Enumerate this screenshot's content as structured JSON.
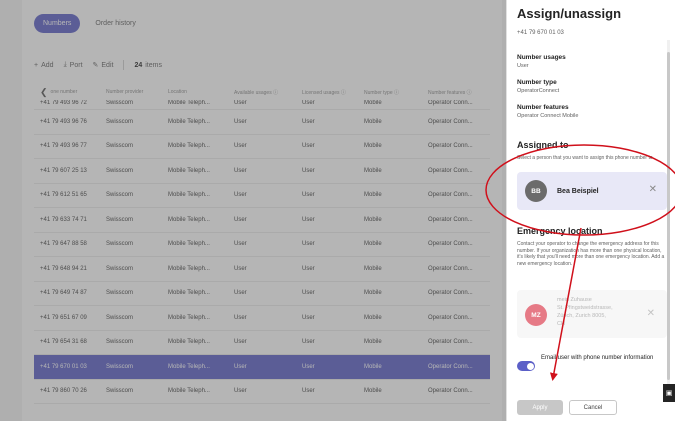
{
  "tabs": [
    {
      "label": "Numbers"
    },
    {
      "label": "Order history"
    }
  ],
  "toolbar": {
    "add": "Add",
    "port": "Port",
    "edit": "Edit",
    "count": "24",
    "items": "items"
  },
  "table": {
    "headers": [
      "one number",
      "Number provider",
      "Location",
      "Available usages",
      "Licensed usages",
      "Number type",
      "Number features"
    ],
    "first_row": {
      "number": "+41 79 493 96 72",
      "provider": "Swisscom",
      "location": "Mobile Teleph...",
      "available": "User",
      "licensed": "User",
      "type": "Mobile",
      "features": "Operator Conn..."
    },
    "rows": [
      {
        "number": "+41 79 493 96 76",
        "provider": "Swisscom",
        "location": "Mobile Teleph...",
        "available": "User",
        "licensed": "User",
        "type": "Mobile",
        "features": "Operator Conn..."
      },
      {
        "number": "+41 79 493 96 77",
        "provider": "Swisscom",
        "location": "Mobile Teleph...",
        "available": "User",
        "licensed": "User",
        "type": "Mobile",
        "features": "Operator Conn..."
      },
      {
        "number": "+41 79 607 25 13",
        "provider": "Swisscom",
        "location": "Mobile Teleph...",
        "available": "User",
        "licensed": "User",
        "type": "Mobile",
        "features": "Operator Conn..."
      },
      {
        "number": "+41 79 612 51 65",
        "provider": "Swisscom",
        "location": "Mobile Teleph...",
        "available": "User",
        "licensed": "User",
        "type": "Mobile",
        "features": "Operator Conn..."
      },
      {
        "number": "+41 79 633 74 71",
        "provider": "Swisscom",
        "location": "Mobile Teleph...",
        "available": "User",
        "licensed": "User",
        "type": "Mobile",
        "features": "Operator Conn..."
      },
      {
        "number": "+41 79 647 88 58",
        "provider": "Swisscom",
        "location": "Mobile Teleph...",
        "available": "User",
        "licensed": "User",
        "type": "Mobile",
        "features": "Operator Conn..."
      },
      {
        "number": "+41 79 648 94 21",
        "provider": "Swisscom",
        "location": "Mobile Teleph...",
        "available": "User",
        "licensed": "User",
        "type": "Mobile",
        "features": "Operator Conn..."
      },
      {
        "number": "+41 79 649 74 87",
        "provider": "Swisscom",
        "location": "Mobile Teleph...",
        "available": "User",
        "licensed": "User",
        "type": "Mobile",
        "features": "Operator Conn..."
      },
      {
        "number": "+41 79 651 67 09",
        "provider": "Swisscom",
        "location": "Mobile Teleph...",
        "available": "User",
        "licensed": "User",
        "type": "Mobile",
        "features": "Operator Conn..."
      },
      {
        "number": "+41 79 654 31 68",
        "provider": "Swisscom",
        "location": "Mobile Teleph...",
        "available": "User",
        "licensed": "User",
        "type": "Mobile",
        "features": "Operator Conn..."
      },
      {
        "number": "+41 79 670 01 03",
        "provider": "Swisscom",
        "location": "Mobile Teleph...",
        "available": "User",
        "licensed": "User",
        "type": "Mobile",
        "features": "Operator Conn...",
        "selected": true
      },
      {
        "number": "+41 79 860 70 26",
        "provider": "Swisscom",
        "location": "Mobile Teleph...",
        "available": "User",
        "licensed": "User",
        "type": "Mobile",
        "features": "Operator Conn..."
      }
    ]
  },
  "panel": {
    "title": "Assign/unassign",
    "number": "+41 79 670 01 03",
    "usages_label": "Number usages",
    "usages_value": "User",
    "type_label": "Number type",
    "type_value": "OperatorConnect",
    "features_label": "Number features",
    "features_value": "Operator Connect Mobile",
    "assigned_heading": "Assigned to",
    "assigned_hint": "Select a person that you want to assign this phone number to.",
    "person_initials": "BB",
    "person_name": "Bea Beispiel",
    "emergency_heading": "Emergency location",
    "emergency_text": "Contact your operator to change the emergency address for this number. If your organization has more than one physical location, it's likely that you'll need more than one emergency location. Add a new emergency location.",
    "location_initials": "MZ",
    "location_name": "mein Zuhause",
    "location_street": "St. Pfingstweidstrasse,",
    "location_city": "Zürich, Zurich 8005,",
    "location_country": "CH",
    "toggle_label": "Email user with phone number information",
    "toggle_on": true,
    "apply": "Apply",
    "cancel": "Cancel"
  },
  "colors": {
    "accent": "#5b5fc7",
    "annotation": "#d0101b"
  }
}
